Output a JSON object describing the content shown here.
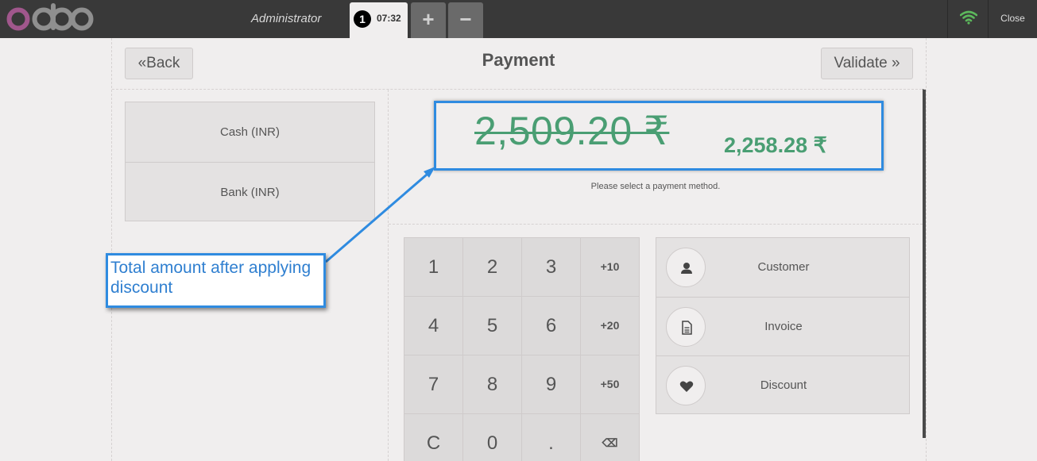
{
  "app": {
    "logo_text": "odoo",
    "user": "Administrator",
    "close_label": "Close",
    "colors": {
      "topbar": "#393939",
      "accent_green": "#4a9e73",
      "annotation_blue": "#2f8be0",
      "wifi": "#5cb85c"
    }
  },
  "order_tab": {
    "number": "1",
    "time": "07:32"
  },
  "tabs": {
    "add_label": "+",
    "remove_label": "−"
  },
  "header": {
    "title": "Payment",
    "back_label": "Back",
    "validate_label": "Validate"
  },
  "payment_methods": [
    {
      "label": "Cash (INR)"
    },
    {
      "label": "Bank (INR)"
    }
  ],
  "totals": {
    "original": "2,509.20 ₹",
    "discounted": "2,258.28 ₹",
    "hint": "Please select a payment method."
  },
  "numpad": {
    "keys": [
      "1",
      "2",
      "3",
      "+10",
      "4",
      "5",
      "6",
      "+20",
      "7",
      "8",
      "9",
      "+50",
      "C",
      "0",
      ".",
      "⌫"
    ]
  },
  "actions": [
    {
      "label": "Customer",
      "icon": "user-icon"
    },
    {
      "label": "Invoice",
      "icon": "document-icon"
    },
    {
      "label": "Discount",
      "icon": "heart-icon"
    }
  ],
  "annotation": {
    "text": "Total amount after applying discount"
  }
}
